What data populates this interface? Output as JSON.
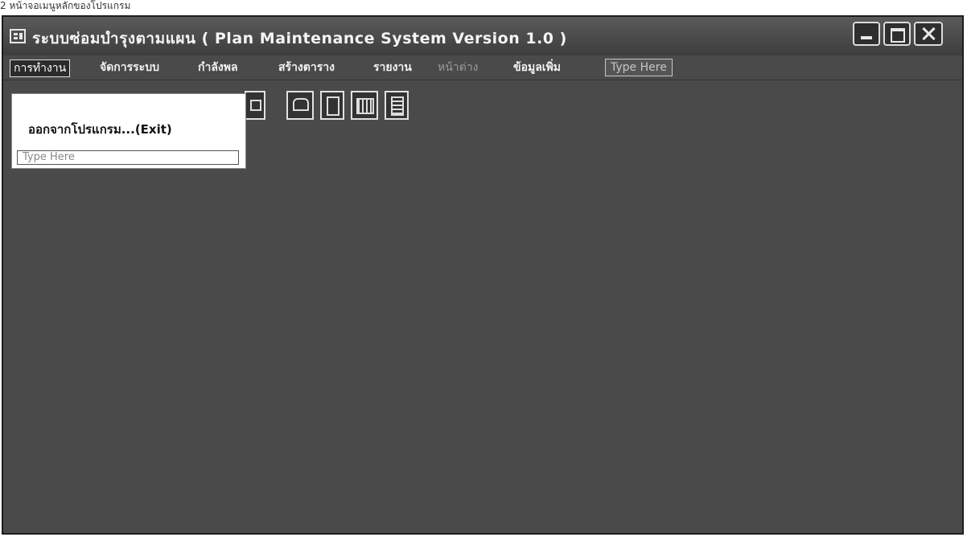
{
  "scan_header": "2 หน้าจอเมนูหลักของโปรแกรม",
  "window": {
    "title": "ระบบซ่อมบำรุงตามแผน ( Plan Maintenance System Version 1.0 )",
    "controls": {
      "minimize": "minimize",
      "maximize": "maximize",
      "close": "close"
    }
  },
  "menu": {
    "items": [
      {
        "label": "การทำงาน",
        "state": "active"
      },
      {
        "label": "จัดการระบบ",
        "state": "normal"
      },
      {
        "label": "กำลังพล",
        "state": "normal"
      },
      {
        "label": "สร้างตาราง",
        "state": "normal"
      },
      {
        "label": "รายงาน",
        "state": "normal"
      },
      {
        "label": "หน้าต่าง",
        "state": "disabled"
      },
      {
        "label": "ข้อมูลเพิ่ม",
        "state": "normal"
      }
    ],
    "type_here": "Type Here"
  },
  "dropdown": {
    "items": [
      {
        "label": "ออกจากโปรแกรม...(Exit)"
      }
    ],
    "type_here": "Type Here"
  },
  "toolbar": {
    "icons": [
      "window-icon",
      "open-folder-icon",
      "document-icon",
      "grid-icon",
      "report-icon"
    ]
  },
  "colors": {
    "window_bg": "#4a4a4a",
    "menu_text": "#f2f2f2",
    "menu_disabled": "#9b9b9b",
    "dropdown_bg": "#ffffff"
  }
}
